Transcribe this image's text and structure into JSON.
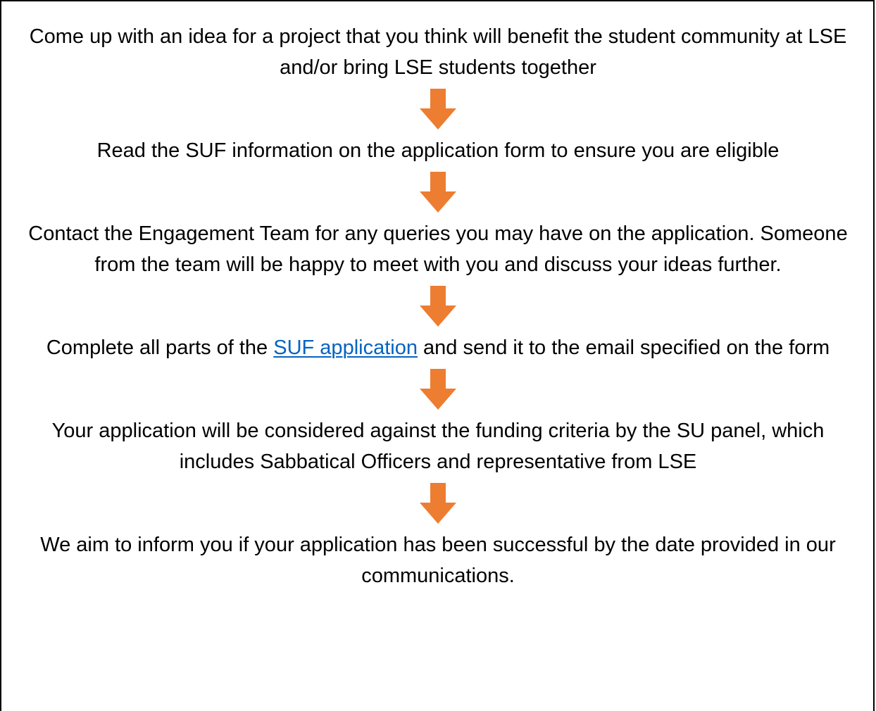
{
  "steps": [
    {
      "text": "Come up with an idea for a project that you think will benefit the student community at LSE and/or bring LSE students together"
    },
    {
      "text": "Read the SUF information on the application form to ensure you are eligible"
    },
    {
      "text": "Contact the Engagement Team for any queries you may have on the application. Someone from the team will be happy to meet with you and discuss your ideas further."
    },
    {
      "text_before": "Complete all parts of the ",
      "link_text": "SUF application",
      "text_after": " and send it to the email specified on the form"
    },
    {
      "text": "Your application will be considered against the funding criteria by the SU panel, which includes Sabbatical Officers and representative from LSE"
    },
    {
      "text": "We aim to inform you if your application has been successful by the date provided in our communications."
    }
  ],
  "arrow": {
    "icon": "down-arrow-icon",
    "color": "#ED7D31"
  },
  "link_color": "#0563C1"
}
